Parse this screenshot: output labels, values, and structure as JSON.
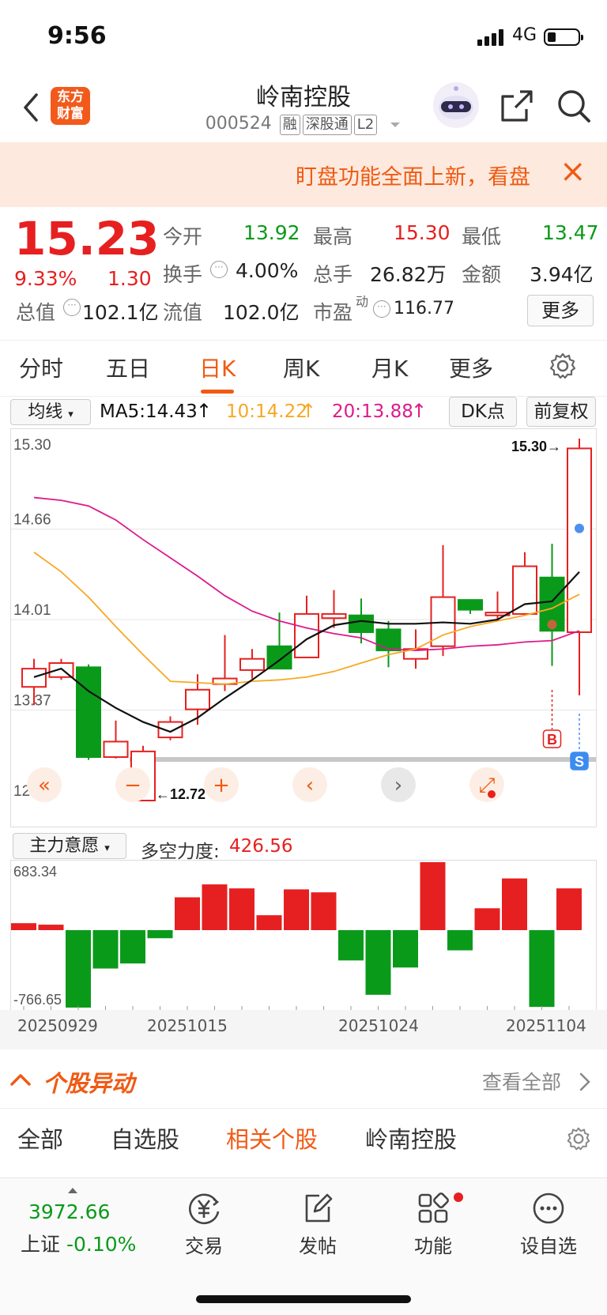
{
  "status": {
    "time": "9:56",
    "network": "4G"
  },
  "header": {
    "logo_line1": "东方",
    "logo_line2": "财富",
    "title": "岭南控股",
    "code": "000524",
    "tags": [
      "融",
      "深股通",
      "L2"
    ]
  },
  "banner": {
    "text": "盯盘功能全面上新，看盘"
  },
  "quote": {
    "price": "15.23",
    "change_pct": "9.33%",
    "change": "1.30",
    "fields": [
      {
        "label": "今开",
        "value": "13.92",
        "tone": "green"
      },
      {
        "label": "最高",
        "value": "15.30",
        "tone": "red"
      },
      {
        "label": "最低",
        "value": "13.47",
        "tone": "green"
      },
      {
        "label": "换手",
        "value": "4.00%",
        "tone": "plain"
      },
      {
        "label": "总手",
        "value": "26.82万",
        "tone": "plain"
      },
      {
        "label": "金额",
        "value": "3.94亿",
        "tone": "plain"
      },
      {
        "label": "总值",
        "value": "102.1亿",
        "tone": "plain"
      },
      {
        "label": "流值",
        "value": "102.0亿",
        "tone": "plain"
      },
      {
        "label": "市盈",
        "value": "116.77",
        "tone": "plain",
        "sup": "动"
      }
    ],
    "more": "更多"
  },
  "period_tabs": [
    "分时",
    "五日",
    "日K",
    "周K",
    "月K",
    "更多"
  ],
  "active_period": "日K",
  "ma": {
    "selector": "均线",
    "ma5": "MA5:14.43",
    "ma10": "10:14.22",
    "ma20": "20:13.88",
    "dk": "DK点",
    "fq": "前复权"
  },
  "colors": {
    "up": "#e62020",
    "down": "#0a9a1a",
    "ma5": "#111111",
    "ma10": "#f7a823",
    "ma20": "#dd1a8c",
    "accent": "#f05a14"
  },
  "chart_data": [
    {
      "type": "candlestick",
      "y_axis_labels": [
        "15.30",
        "14.66",
        "14.01",
        "13.37",
        "12.72"
      ],
      "ylim": [
        12.72,
        15.3
      ],
      "high_marker": "15.30→",
      "low_marker": "←12.72",
      "candles": [
        {
          "o": 13.53,
          "c": 13.66,
          "h": 13.73,
          "l": 13.4
        },
        {
          "o": 13.6,
          "c": 13.7,
          "h": 13.73,
          "l": 13.58
        },
        {
          "o": 13.67,
          "c": 13.03,
          "h": 13.69,
          "l": 13.01
        },
        {
          "o": 13.03,
          "c": 13.14,
          "h": 13.29,
          "l": 13.02
        },
        {
          "o": 12.72,
          "c": 13.07,
          "h": 13.11,
          "l": 12.72
        },
        {
          "o": 13.17,
          "c": 13.28,
          "h": 13.32,
          "l": 13.15
        },
        {
          "o": 13.37,
          "c": 13.51,
          "h": 13.62,
          "l": 13.26
        },
        {
          "o": 13.55,
          "c": 13.59,
          "h": 13.9,
          "l": 13.5
        },
        {
          "o": 13.65,
          "c": 13.73,
          "h": 13.8,
          "l": 13.59
        },
        {
          "o": 13.82,
          "c": 13.66,
          "h": 14.06,
          "l": 13.66
        },
        {
          "o": 13.74,
          "c": 14.05,
          "h": 14.18,
          "l": 13.74
        },
        {
          "o": 14.02,
          "c": 14.05,
          "h": 14.22,
          "l": 13.95
        },
        {
          "o": 14.04,
          "c": 13.92,
          "h": 14.16,
          "l": 13.84
        },
        {
          "o": 13.94,
          "c": 13.79,
          "h": 14.0,
          "l": 13.67
        },
        {
          "o": 13.73,
          "c": 13.8,
          "h": 13.94,
          "l": 13.66
        },
        {
          "o": 13.82,
          "c": 14.17,
          "h": 14.54,
          "l": 13.75
        },
        {
          "o": 14.15,
          "c": 14.08,
          "h": 14.15,
          "l": 14.05
        },
        {
          "o": 14.04,
          "c": 14.06,
          "h": 14.21,
          "l": 14.0
        },
        {
          "o": 14.05,
          "c": 14.39,
          "h": 14.49,
          "l": 14.04
        },
        {
          "o": 14.31,
          "c": 13.93,
          "h": 14.55,
          "l": 13.68
        },
        {
          "o": 13.92,
          "c": 15.23,
          "h": 15.3,
          "l": 13.47
        }
      ],
      "ma5": [
        13.6,
        13.66,
        13.5,
        13.38,
        13.28,
        13.21,
        13.31,
        13.45,
        13.58,
        13.72,
        13.87,
        13.97,
        14.0,
        13.98,
        13.98,
        13.99,
        13.98,
        14.01,
        14.12,
        14.14,
        14.35
      ],
      "ma10": [
        14.49,
        14.35,
        14.17,
        13.96,
        13.76,
        13.57,
        13.56,
        13.55,
        13.57,
        13.58,
        13.6,
        13.64,
        13.7,
        13.76,
        13.8,
        13.9,
        13.96,
        14.0,
        14.04,
        14.09,
        14.19
      ],
      "ma20": [
        14.88,
        14.86,
        14.82,
        14.72,
        14.58,
        14.45,
        14.32,
        14.18,
        14.07,
        14.0,
        13.95,
        13.91,
        13.88,
        13.8,
        13.79,
        13.8,
        13.82,
        13.83,
        13.85,
        13.86,
        13.93
      ],
      "signals": [
        {
          "label": "B",
          "index": 19
        },
        {
          "label": "S",
          "index": 20
        }
      ]
    },
    {
      "type": "bar",
      "title": "主力意愿",
      "metric_label": "多空力度:",
      "metric_value": "426.56",
      "y_axis_labels": [
        "683.34",
        "-766.65"
      ],
      "ylim": [
        -766.65,
        683.34
      ],
      "values": [
        70,
        55,
        -766.65,
        -380,
        -330,
        -80,
        330,
        460,
        420,
        150,
        410,
        380,
        -300,
        -640,
        -370,
        683.34,
        -200,
        220,
        520,
        -760,
        420
      ],
      "x_tick_labels": [
        "20250929",
        "20251015",
        "20251024",
        "20251104"
      ]
    }
  ],
  "movement": {
    "title": "个股异动",
    "view_all": "查看全部"
  },
  "sub_tabs": [
    "全部",
    "自选股",
    "相关个股",
    "岭南控股"
  ],
  "active_sub_tab": "相关个股",
  "bottom_nav": {
    "index_value": "3972.66",
    "index_name": "上证",
    "index_change": "-0.10%",
    "items": [
      "交易",
      "发帖",
      "功能",
      "设自选"
    ]
  }
}
